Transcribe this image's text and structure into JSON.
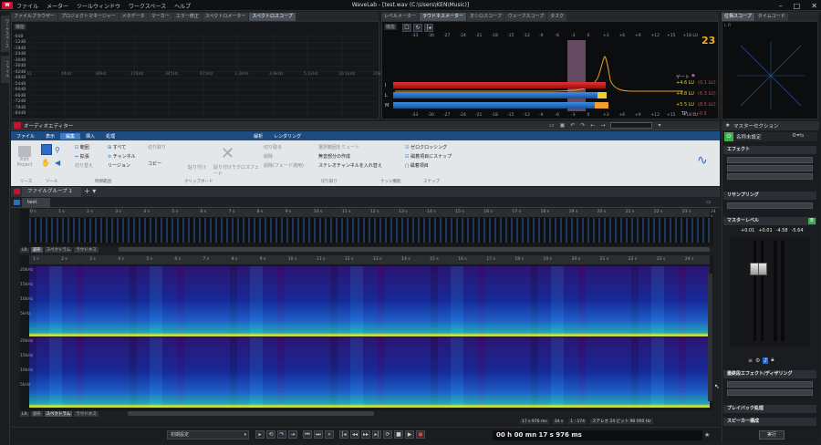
{
  "app": {
    "title": "WaveLab - [test.wav (C:\\Users\\KEN\\Music)]",
    "logo": "W"
  },
  "menu": [
    "ファイル",
    "メーター",
    "ツールウィンドウ",
    "ワークスペース",
    "ヘルプ"
  ],
  "window_controls": {
    "minimize": "–",
    "maximize": "□",
    "close": "✕"
  },
  "left_strip": [
    "ワークスペース",
    "ファイル"
  ],
  "top_left_tabs": [
    "ファイルブラウザー",
    "プロジェクトマネージャー",
    "メタデータ",
    "マーカー",
    "エラー修正",
    "スペクトロメーター",
    "スペクトロスコープ"
  ],
  "top_left_active": 6,
  "spectro_function": "機能",
  "spectro_freqs": [
    "31",
    "44Hz",
    "89Hz",
    "170Hz",
    "345Hz",
    "670Hz",
    "1.3kHz",
    "2.6kHz",
    "5.1kHz",
    "10.1kHz",
    "20kHz"
  ],
  "spectro_db": [
    "-6dB",
    "-12dB",
    "-18dB",
    "-24dB",
    "-30dB",
    "-36dB",
    "-42dB",
    "-48dB",
    "-54dB",
    "-60dB",
    "-66dB",
    "-72dB",
    "-78dB",
    "-84dB"
  ],
  "top_mid_tabs": [
    "レベルメーター",
    "ラウドネスメーター",
    "オシロスコープ",
    "ウェーブスコープ",
    "タスク"
  ],
  "top_mid_active": 1,
  "loud_function": "機能",
  "loud_scale": [
    "-33",
    "-30",
    "-27",
    "-24",
    "-21",
    "-18",
    "-15",
    "-12",
    "-9",
    "-6",
    "-3",
    "0",
    "+3",
    "+6",
    "+9",
    "+12",
    "+15",
    "+18 LU"
  ],
  "loud_rows": [
    "I",
    "L",
    "M"
  ],
  "loud_gate_label": "ゲート",
  "loud_values": [
    {
      "value": "+4.6 LU",
      "max": "(0.1 LU)"
    },
    {
      "value": "+4.8 LU",
      "max": "(6.3 LU)"
    },
    {
      "value": "+5.5 LU",
      "max": "(8.5 LU)"
    }
  ],
  "loud_tp": {
    "label": "TP",
    "value": "+ -0.3"
  },
  "loud_logo": "23",
  "top_right_tabs": [
    "位相スコープ",
    "タイムコード"
  ],
  "top_right_active": 0,
  "phase_label": "L R",
  "audio_editor": {
    "title": "オーディオエディター",
    "ribbon_tabs": [
      "ファイル",
      "表示",
      "編集",
      "挿入",
      "処理",
      "解析",
      "レンダリング"
    ],
    "ribbon_active": 2,
    "groups": [
      {
        "name": "ソース",
        "items": [
          "Edit Project"
        ]
      },
      {
        "name": "ツール",
        "items": []
      },
      {
        "name": "時間範囲",
        "items": [
          "範囲",
          "すべて",
          "拡張",
          "チャンネル",
          "切り替え",
          "リージョン"
        ]
      },
      {
        "name": "クリップボード",
        "items": [
          "切り取り",
          "コピー",
          "貼り付け",
          "貼り付けでクロスフェード"
        ]
      },
      {
        "name": "切り取り",
        "items": [
          "切り取る",
          "削除",
          "削除(フェード適用)",
          "選択範囲をミュート",
          "無音部分の作成",
          "ステレオチャンネルを入れ替え"
        ]
      },
      {
        "name": "ナッジ機能",
        "items": []
      },
      {
        "name": "スナップ",
        "items": [
          "ゼロクロッシング",
          "磁着項目にスナップ",
          "磁着項目"
        ]
      }
    ],
    "file_group": "ファイルグループ 1",
    "file_tab": "test",
    "overview_ticks": [
      "0 s",
      "1 s",
      "2 s",
      "3 s",
      "4 s",
      "5 s",
      "6 s",
      "7 s",
      "8 s",
      "9 s",
      "10 s",
      "11 s",
      "12 s",
      "13 s",
      "14 s",
      "15 s",
      "16 s",
      "17 s",
      "18 s",
      "19 s",
      "20 s",
      "21 s",
      "22 s",
      "23 s",
      "24 s"
    ],
    "view_tabs_overview": [
      "LR",
      "波形",
      "スペクトラム",
      "ラウドネス"
    ],
    "view_tabs_main": [
      "LR",
      "波形",
      "スペクトラム",
      "ラウドネス"
    ],
    "main_ticks": [
      "1 s",
      "2 s",
      "3 s",
      "4 s",
      "5 s",
      "6 s",
      "7 s",
      "8 s",
      "9 s",
      "10 s",
      "11 s",
      "12 s",
      "13 s",
      "14 s",
      "15 s",
      "16 s",
      "17 s",
      "18 s",
      "19 s",
      "20 s",
      "21 s",
      "22 s",
      "23 s",
      "24 s"
    ],
    "freq_labels": [
      "20kHz",
      "15kHz",
      "10kHz",
      "5kHz",
      "20kHz",
      "15kHz",
      "10kHz",
      "5kHz"
    ],
    "status": {
      "length": "17 s 976 ms",
      "duration": "34 s",
      "zoom": "1 : 174",
      "format": "ステレオ 24 ビット 96 000 Hz",
      "dur_unit": "34 s"
    }
  },
  "transport": {
    "preset": "初期設定",
    "time": "00 h 00 mn 17 s 976 ms"
  },
  "master": {
    "title": "マスターセクション",
    "preset": "名称未設定",
    "effects": "エフェクト",
    "resampling": "リサンプリング",
    "master_level": "マスターレベル",
    "levels": [
      "+0.01",
      "+0.01",
      "-4.58",
      "-5.64"
    ],
    "final_effects": "最終段エフェクト/ディザリング",
    "playback": "プレイバック処理",
    "speaker": "スピーカー構成",
    "render": "実行"
  },
  "colors": {
    "accent": "#3a8fd8",
    "brand": "#c41230",
    "green": "#38b048"
  }
}
